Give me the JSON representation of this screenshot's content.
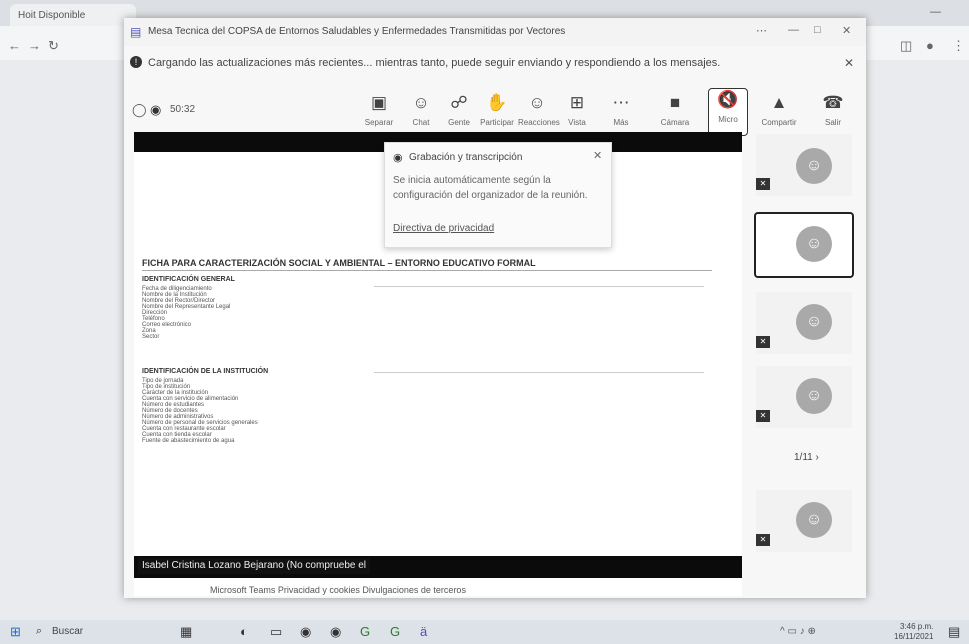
{
  "browser": {
    "tab1": "Hoit Disponible",
    "tab2": "Mesa Tecnica del COPSA",
    "window_controls": [
      "—",
      "□",
      "✕"
    ]
  },
  "window": {
    "title": "Mesa Tecnica del COPSA de Entornos Saludables y Enfermedades Transmitidas por Vectores",
    "notice": "Cargando las actualizaciones más recientes... mientras tanto, puede seguir enviando y respondiendo a los mensajes.",
    "timer": "50:32"
  },
  "toolbar": [
    {
      "icon": "pin-icon",
      "glyph": "▣",
      "label": "Separar"
    },
    {
      "icon": "chat-icon",
      "glyph": "☺",
      "label": "Chat"
    },
    {
      "icon": "people-icon",
      "glyph": "☍",
      "label": "Gente"
    },
    {
      "icon": "hand-icon",
      "glyph": "✋",
      "label": "Participar"
    },
    {
      "icon": "reaction-icon",
      "glyph": "☺",
      "label": "Reacciones"
    },
    {
      "icon": "view-icon",
      "glyph": "⊞",
      "label": "Vista"
    },
    {
      "icon": "more-icon",
      "glyph": "⋯",
      "label": "Más"
    },
    {
      "icon": "camera-icon",
      "glyph": "■",
      "label": "Cámara"
    },
    {
      "icon": "mic-icon",
      "glyph": "🔇",
      "label": "Micro"
    },
    {
      "icon": "share-icon",
      "glyph": "▲",
      "label": "Compartir"
    },
    {
      "icon": "leave-icon",
      "glyph": "☎",
      "label": "Salir"
    }
  ],
  "popup": {
    "title": "Grabación y transcripción",
    "body": "Se inicia automáticamente según la configuración del organizador de la reunión.",
    "link": "Directiva de privacidad"
  },
  "document": {
    "title": "FICHA PARA CARACTERIZACIÓN SOCIAL Y AMBIENTAL – ENTORNO EDUCATIVO FORMAL",
    "section1": "IDENTIFICACIÓN GENERAL",
    "section2": "IDENTIFICACIÓN DE LA INSTITUCIÓN",
    "rows1": [
      "Fecha de diligenciamiento",
      "Nombre de la Institución",
      "Nombre del Rector/Director",
      "Nombre del Representante Legal",
      "Dirección",
      "Teléfono",
      "Correo electrónico",
      "Zona",
      "Sector"
    ],
    "rows2": [
      "Tipo de jornada",
      "Tipo de institución",
      "Carácter de la institución",
      "Cuenta con servicio de alimentación",
      "Número de estudiantes",
      "Número de docentes",
      "Número de administrativos",
      "Número de personal de servicios generales",
      "Cuenta con restaurante escolar",
      "Cuenta con tienda escolar",
      "Fuente de abastecimiento de agua"
    ]
  },
  "caption": "Isabel Cristina Lozano Bejarano (No compruebe el",
  "pagination": "1/11",
  "footer": "Microsoft Teams   Privacidad y cookies   Divulgaciones de terceros",
  "taskbar": {
    "search": "Buscar",
    "time": "3:46 p.m.",
    "date": "16/11/2021"
  }
}
